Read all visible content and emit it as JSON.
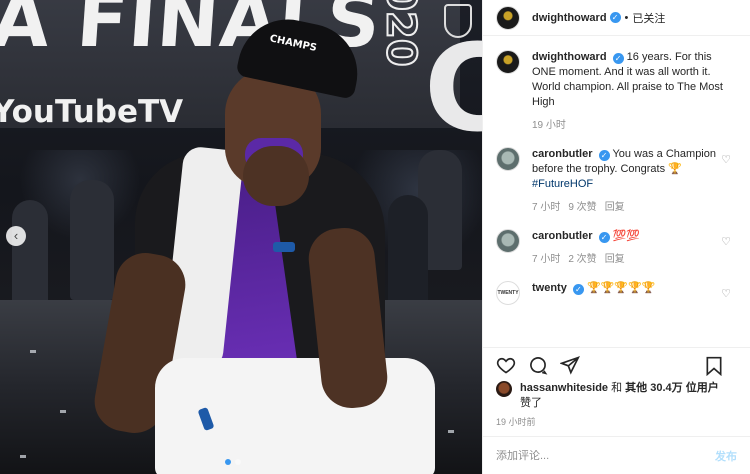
{
  "photo": {
    "banner_text": "A FINALS",
    "banner_sub": "YouTubeTV",
    "banner_year": "2020",
    "cap_label": "CHAMPS",
    "carousel_prev": "‹"
  },
  "header": {
    "username": "dwighthoward",
    "verified": "✓",
    "separator": "•",
    "follow_label": "已关注"
  },
  "caption": {
    "username": "dwighthoward",
    "text": "16 years. For this ONE moment. And it was all worth it. World champion. All praise to The Most High",
    "time": "19 小时"
  },
  "comments": [
    {
      "username": "caronbutler",
      "text": "You was a Champion before the trophy. Congrats",
      "emoji": "🏆",
      "hashtag": "#FutureHOF",
      "time": "7 小时",
      "likes": "9 次赞",
      "reply": "回复"
    },
    {
      "username": "caronbutler",
      "text": "💯💯",
      "time": "7 小时",
      "likes": "2 次赞",
      "reply": "回复"
    },
    {
      "username": "twenty",
      "text": "🏆🏆🏆🏆🏆",
      "avatar_text": "TWENTY"
    }
  ],
  "actions": {
    "like_icon": "heart-outline",
    "comment_icon": "comment-bubble",
    "share_icon": "paper-plane",
    "save_icon": "bookmark"
  },
  "likes": {
    "user": "hassanwhiteside",
    "conj": " 和 ",
    "others": "其他 30.4万 位用户",
    "suffix": "赞了"
  },
  "posted_ago": "19 小时前",
  "composer": {
    "placeholder": "添加评论...",
    "post_label": "发布"
  }
}
